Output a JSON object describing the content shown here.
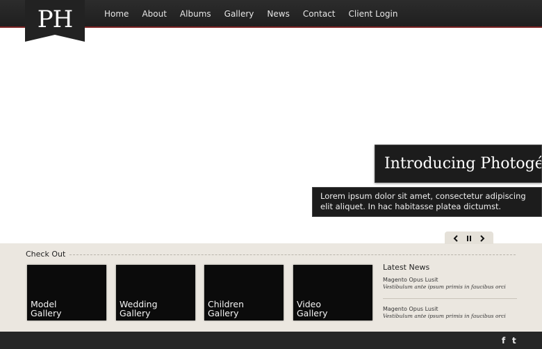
{
  "logo": {
    "text": "PH"
  },
  "nav": {
    "items": [
      "Home",
      "About",
      "Albums",
      "Gallery",
      "News",
      "Contact",
      "Client Login"
    ]
  },
  "hero": {
    "title": "Introducing Photogé",
    "subtitle": "Lorem ipsum dolor sit amet, consectetur adipiscing elit aliquet. In hac habitasse platea dictumst."
  },
  "slider": {
    "prev_icon": "chevron-left",
    "pause_icon": "pause",
    "next_icon": "chevron-right"
  },
  "checkout": {
    "heading": "Check Out",
    "galleries": [
      {
        "line1": "Model",
        "line2": "Gallery"
      },
      {
        "line1": "Wedding",
        "line2": "Gallery"
      },
      {
        "line1": "Children",
        "line2": "Gallery"
      },
      {
        "line1": "Video",
        "line2": "Gallery"
      }
    ]
  },
  "news": {
    "heading": "Latest News",
    "items": [
      {
        "title": "Magento Opus Lusit",
        "desc": "Vestibulum ante ipsum primis in faucibus orci"
      },
      {
        "title": "Magento Opus Lusit",
        "desc": "Vestibulum ante ipsum primis in faucibus orci"
      }
    ]
  },
  "footer": {
    "social": [
      {
        "icon": "facebook-icon",
        "glyph": "f"
      },
      {
        "icon": "twitter-icon",
        "glyph": "t"
      }
    ]
  },
  "colors": {
    "header_bg": "#262626",
    "accent_line": "#7b2222",
    "band_bg": "#ebe7e0"
  }
}
